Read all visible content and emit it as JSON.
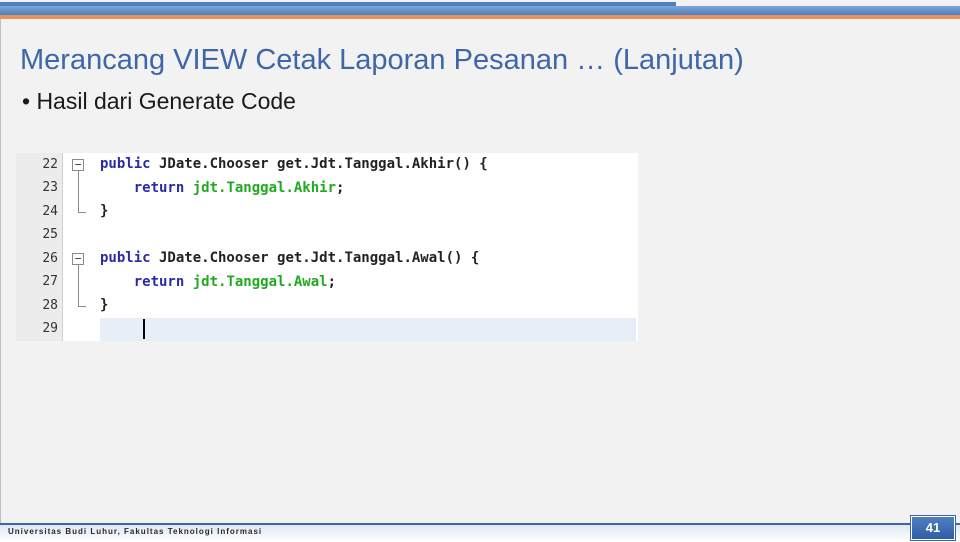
{
  "slide": {
    "title": "Merancang VIEW Cetak Laporan Pesanan … (Lanjutan)",
    "bullet": "• Hasil dari Generate Code",
    "footer": "Universitas Budi Luhur, Fakultas Teknologi Informasi",
    "page_number": "41"
  },
  "editor": {
    "line_numbers": [
      "22",
      "23",
      "24",
      "25",
      "26",
      "27",
      "28",
      "29"
    ],
    "fold_icon": "−",
    "lines": [
      {
        "indent": "",
        "kw": "public",
        "text": " JDate.Chooser get.Jdt.Tanggal.Akhir() {",
        "fld": "",
        "tail": ""
      },
      {
        "indent": "    ",
        "kw": "return",
        "text": " ",
        "fld": "jdt.Tanggal.Akhir",
        "tail": ";"
      },
      {
        "indent": "",
        "kw": "",
        "text": "}",
        "fld": "",
        "tail": ""
      },
      {
        "indent": "",
        "kw": "",
        "text": "",
        "fld": "",
        "tail": ""
      },
      {
        "indent": "",
        "kw": "public",
        "text": " JDate.Chooser get.Jdt.Tanggal.Awal() {",
        "fld": "",
        "tail": ""
      },
      {
        "indent": "    ",
        "kw": "return",
        "text": " ",
        "fld": "jdt.Tanggal.Awal",
        "tail": ";"
      },
      {
        "indent": "",
        "kw": "",
        "text": "}",
        "fld": "",
        "tail": ""
      },
      {
        "indent": "",
        "kw": "",
        "text": "",
        "fld": "",
        "tail": ""
      }
    ]
  }
}
